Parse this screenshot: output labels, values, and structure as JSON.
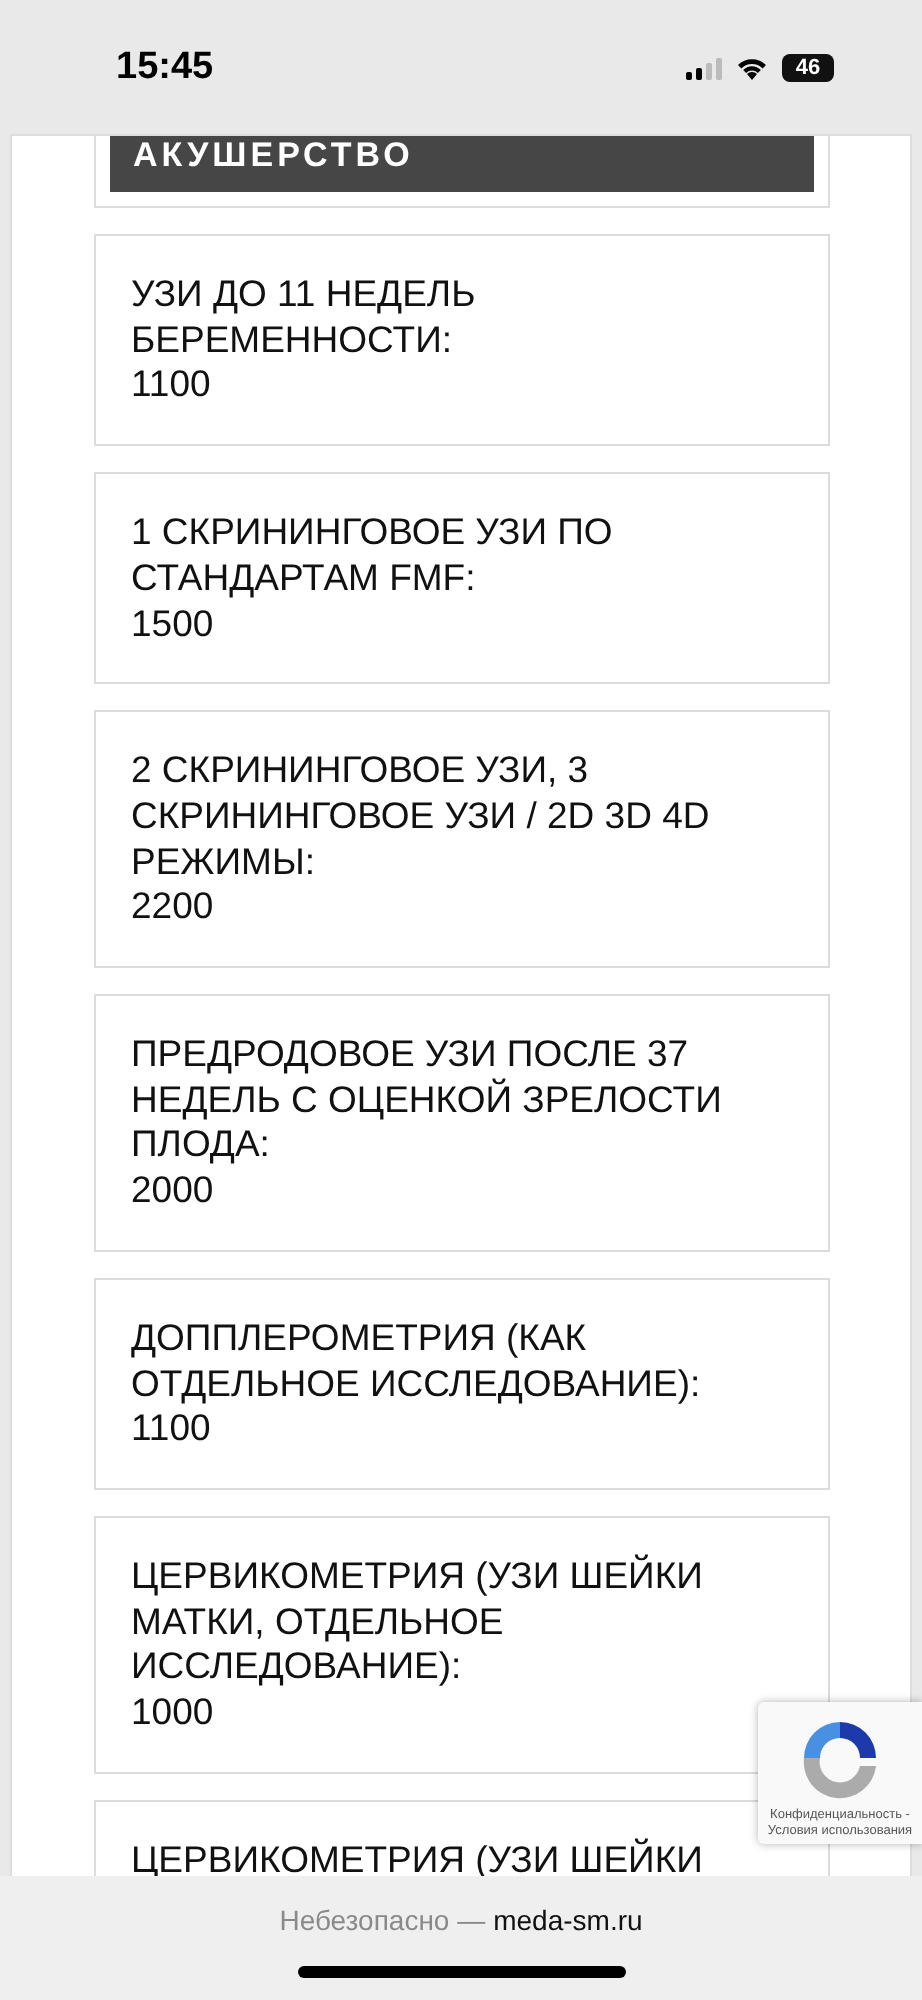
{
  "status_bar": {
    "time": "15:45",
    "battery": "46"
  },
  "section_header": {
    "title": "АКУШЕРСТВО"
  },
  "price_cards": [
    {
      "title": "УЗИ ДО 11 НЕДЕЛЬ БЕРЕМЕННОСТИ:",
      "price": "1100"
    },
    {
      "title": "1 СКРИНИНГОВОЕ УЗИ ПО СТАНДАРТАМ FMF:",
      "price": "1500"
    },
    {
      "title": "2 СКРИНИНГОВОЕ УЗИ, 3 СКРИНИНГОВОЕ УЗИ / 2D 3D 4D РЕЖИМЫ:",
      "price": "2200"
    },
    {
      "title": "ПРЕДРОДОВОЕ УЗИ ПОСЛЕ 37 НЕДЕЛЬ С ОЦЕНКОЙ ЗРЕЛОСТИ ПЛОДА:",
      "price": "2000"
    },
    {
      "title": "ДОППЛЕРОМЕТРИЯ (КАК ОТДЕЛЬНОЕ ИССЛЕДОВАНИЕ):",
      "price": "1100"
    },
    {
      "title": "ЦЕРВИКОМЕТРИЯ (УЗИ ШЕЙКИ МАТКИ, ОТДЕЛЬНОЕ ИССЛЕДОВАНИЕ):",
      "price": "1000"
    },
    {
      "title": "ЦЕРВИКОМЕТРИЯ (УЗИ ШЕЙКИ"
    }
  ],
  "recaptcha": {
    "links": "Конфиденциальность - Условия использования"
  },
  "address_bar": {
    "security": "Небезопасно —",
    "domain": "meda-sm.ru"
  }
}
